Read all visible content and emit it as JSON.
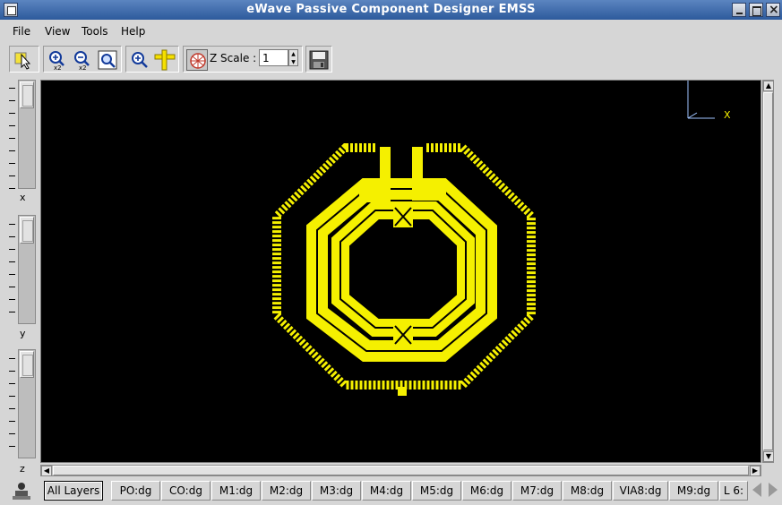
{
  "window": {
    "title": "eWave Passive Component Designer EMSS"
  },
  "menu": {
    "items": [
      "File",
      "View",
      "Tools",
      "Help"
    ]
  },
  "toolbar": {
    "zscale_label": "Z Scale :",
    "zscale_value": "1"
  },
  "sliders": {
    "labels": [
      "x",
      "y",
      "z"
    ]
  },
  "viewport": {
    "axis_label": "X",
    "background_color": "#000000",
    "metal_color": "#f5f000"
  },
  "layers": {
    "tabs": [
      "All Layers",
      "PO:dg",
      "CO:dg",
      "M1:dg",
      "M2:dg",
      "M3:dg",
      "M4:dg",
      "M5:dg",
      "M6:dg",
      "M7:dg",
      "M8:dg",
      "VIA8:dg",
      "M9:dg",
      "L 6:"
    ],
    "active": "All Layers"
  },
  "icons": [
    "select-arrow-icon",
    "zoom-in-x2-icon",
    "zoom-out-x2-icon",
    "zoom-fit-icon",
    "zoom-icon",
    "crosshair-icon",
    "3d-rotate-icon",
    "save-icon",
    "user-icon"
  ]
}
